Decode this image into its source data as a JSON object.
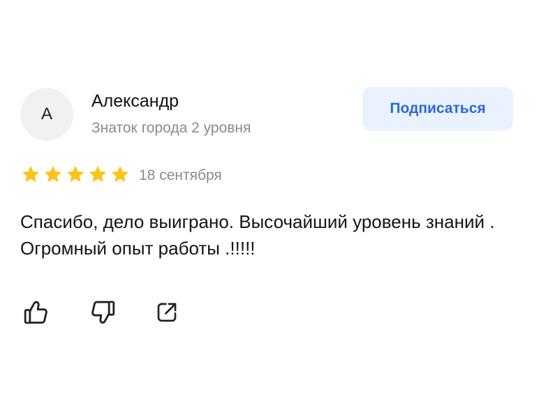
{
  "review": {
    "author": {
      "initial": "А",
      "name": "Александр",
      "level": "Знаток города 2 уровня"
    },
    "subscribe_label": "Подписаться",
    "rating": {
      "stars": 5,
      "max": 5,
      "color": "#fcc419"
    },
    "date": "18 сентября",
    "text": "Спасибо, дело выиграно. Высочайший уровень знаний . Огромный опыт работы .!!!!!"
  },
  "actions": {
    "like_icon": "thumbs-up-icon",
    "dislike_icon": "thumbs-down-icon",
    "share_icon": "share-icon"
  },
  "colors": {
    "accent": "#2a69d8",
    "button_bg": "#eaf2ff",
    "secondary_text": "#8a8a8a",
    "icon": "#222222"
  }
}
